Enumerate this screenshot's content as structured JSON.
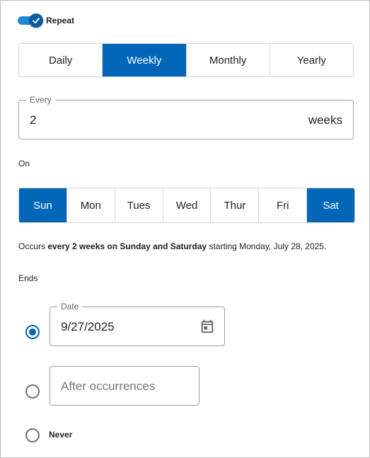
{
  "repeat": {
    "label": "Repeat",
    "enabled": true
  },
  "frequency": {
    "options": [
      "Daily",
      "Weekly",
      "Monthly",
      "Yearly"
    ],
    "selected": "Weekly"
  },
  "every": {
    "legend": "Every",
    "value": "2",
    "suffix": "weeks"
  },
  "on": {
    "label": "On",
    "days": [
      "Sun",
      "Mon",
      "Tues",
      "Wed",
      "Thur",
      "Fri",
      "Sat"
    ],
    "selected": [
      "Sun",
      "Sat"
    ]
  },
  "summary": {
    "prefix": "Occurs ",
    "highlight": "every 2 weeks on Sunday and Saturday",
    "suffix": " starting Monday, July 28, 2025."
  },
  "ends": {
    "label": "Ends",
    "selected_option": "date",
    "date": {
      "legend": "Date",
      "value": "9/27/2025",
      "icon": "calendar-icon"
    },
    "after": {
      "placeholder": "After occurrences",
      "value": ""
    },
    "never": {
      "label": "Never"
    }
  },
  "colors": {
    "accent": "#0067b8",
    "toggle_track": "#1a8ad8",
    "toggle_thumb": "#0d5a9e"
  }
}
